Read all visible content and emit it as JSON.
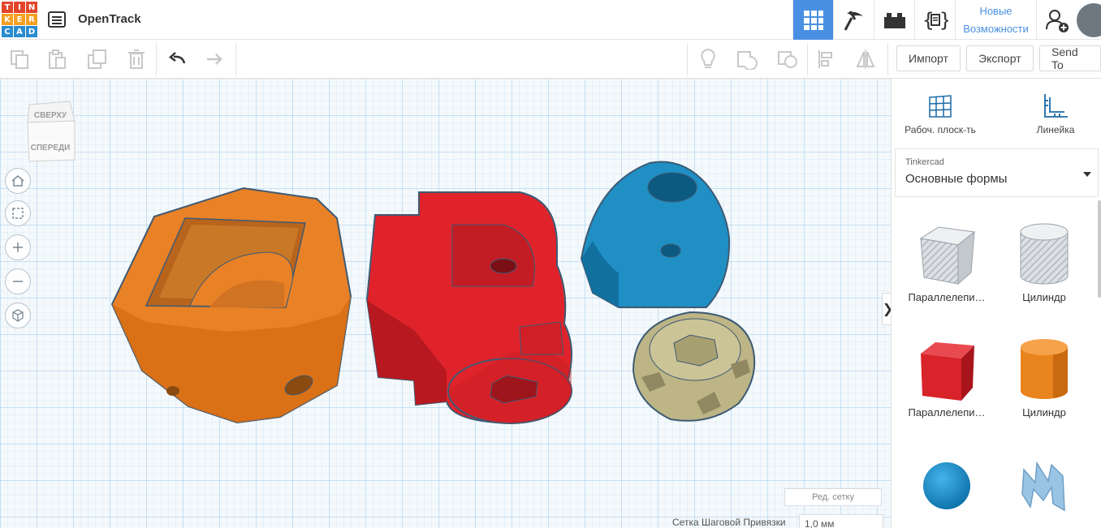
{
  "app": {
    "logo_letters": [
      "T",
      "I",
      "N",
      "K",
      "E",
      "R",
      "C",
      "A",
      "D"
    ],
    "logo_colors": [
      "#e2452b",
      "#e2452b",
      "#e2452b",
      "#f4a023",
      "#f4a023",
      "#f4a023",
      "#2a8bd0",
      "#2a8bd0",
      "#2a8bd0"
    ],
    "project_title": "OpenTrack"
  },
  "topbar": {
    "news_line1": "Новые",
    "news_line2": "Возможности",
    "accent": "#4a90e2",
    "icons": [
      "grid-view-icon",
      "pickaxe-icon",
      "bricks-icon",
      "code-blocks-icon"
    ]
  },
  "toolbar": {
    "import_label": "Импорт",
    "export_label": "Экспорт",
    "send_label": "Send To"
  },
  "viewcube": {
    "top": "СВЕРХУ",
    "front": "СПЕРЕДИ"
  },
  "workplane": {
    "edit_grid_label": "Ред. сетку",
    "snap_label": "Сетка Шаговой Привязки",
    "snap_value": "1,0 мм",
    "objects": [
      {
        "name": "orange-part",
        "color": "#e98126"
      },
      {
        "name": "red-part",
        "color": "#e0232b"
      },
      {
        "name": "blue-part",
        "color": "#1f8fc4"
      },
      {
        "name": "khaki-knob",
        "color": "#bdb586"
      }
    ]
  },
  "panel": {
    "workplane_label": "Рабоч. плоск-ть",
    "ruler_label": "Линейка",
    "library_source": "Tinkercad",
    "library_name": "Основные формы",
    "shapes": [
      {
        "label": "Параллелепи…",
        "kind": "box-hole"
      },
      {
        "label": "Цилиндр",
        "kind": "cylinder-hole"
      },
      {
        "label": "Параллелепи…",
        "kind": "box",
        "color": "#d9232b"
      },
      {
        "label": "Цилиндр",
        "kind": "cylinder",
        "color": "#e8841e"
      },
      {
        "label": "",
        "kind": "sphere",
        "color": "#1a8fd0"
      },
      {
        "label": "",
        "kind": "scribble",
        "color": "#9ac4e4"
      }
    ]
  }
}
